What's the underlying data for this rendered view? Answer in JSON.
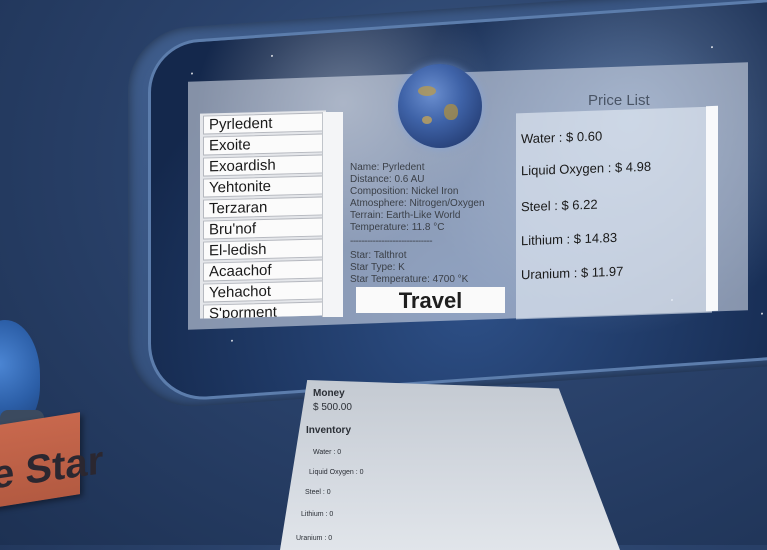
{
  "planets": [
    "Pyrledent",
    "Exoite",
    "Exoardish",
    "Yehtonite",
    "Terzaran",
    "Bru'nof",
    "El-ledish",
    "Acaachof",
    "Yehachot",
    "S'porment"
  ],
  "info": {
    "name": "Name: Pyrledent",
    "distance": "Distance: 0.6 AU",
    "composition": "Composition: Nickel Iron",
    "atmosphere": "Atmosphere: Nitrogen/Oxygen",
    "terrain": "Terrain: Earth-Like World",
    "temperature": "Temperature: 11.8 °C",
    "divider": "-----------------------------",
    "star": "Star: Talthrot",
    "star_type": "Star Type: K",
    "star_temperature": "Star Temperature: 4700 °K"
  },
  "travel_label": "Travel",
  "price_list": {
    "title": "Price List",
    "items": [
      "Water : $ 0.60",
      "Liquid Oxygen : $ 4.98",
      "Steel : $ 6.22",
      "Lithium : $ 14.83",
      "Uranium : $ 11.97"
    ]
  },
  "sign_text": "e Star",
  "inventory": {
    "money_label": "Money",
    "money_value": "$ 500.00",
    "inventory_label": "Inventory",
    "items": [
      "Water : 0",
      "Liquid Oxygen : 0",
      "Steel : 0",
      "Lithium : 0",
      "Uranium : 0"
    ]
  }
}
